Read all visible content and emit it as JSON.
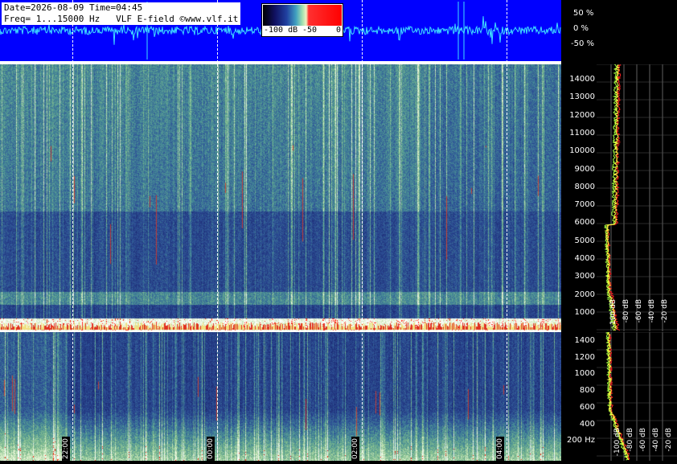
{
  "info": {
    "date_line": "Date=2026-08-09 Time=04:45",
    "freq_line": "Freq= 1...15000 Hz   VLF E-field ©www.vlf.it"
  },
  "colorbar": {
    "labels": [
      "-100 dB",
      "-50",
      "0"
    ]
  },
  "wave_axis": {
    "ticks": [
      "50 %",
      "0 %",
      "-50 %"
    ]
  },
  "freq_axis_top": [
    "14000",
    "13000",
    "12000",
    "11000",
    "10000",
    "9000",
    "8000",
    "7000",
    "6000",
    "5000",
    "4000",
    "3000",
    "2000",
    "1000"
  ],
  "freq_axis_bottom": [
    "1400",
    "1200",
    "1000",
    "800",
    "600",
    "400",
    "200 Hz"
  ],
  "time_marks": [
    "22:00",
    "00:00",
    "02:00",
    "04:00"
  ],
  "profile_db_top": [
    "-100 dB",
    "-80 dB",
    "-60 dB",
    "-40 dB",
    "-20 dB"
  ],
  "profile_db_bottom": [
    "-100 dB",
    "-80 dB",
    "-60 dB",
    "-40 dB",
    "-20 dB"
  ],
  "colors": {
    "wave_bg": "#0000ff",
    "trace": "#40e0ff",
    "profile_green": "#a0ff40",
    "profile_red": "#ff2020",
    "profile_yellow": "#ffff40"
  }
}
